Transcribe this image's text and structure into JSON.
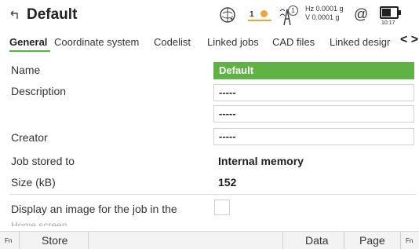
{
  "header": {
    "title": "Default",
    "satellites": "1",
    "tilt_badge": "1",
    "accuracy_hz": "Hz 0.0001 g",
    "accuracy_v": "V  0.0001 g",
    "at_symbol": "@",
    "time": "10:17",
    "battery_level": 0.7
  },
  "tabs": {
    "items": [
      "General",
      "Coordinate system",
      "Codelist",
      "Linked jobs",
      "CAD files",
      "Linked desigr"
    ],
    "active": "General",
    "nav_arrows": "< >"
  },
  "form": {
    "name_label": "Name",
    "name_value": "Default",
    "description_label": "Description",
    "description_value_1": "-----",
    "description_value_2": "-----",
    "creator_label": "Creator",
    "creator_value": "-----",
    "stored_label": "Job stored to",
    "stored_value": "Internal memory",
    "size_label": "Size (kB)",
    "size_value": "152",
    "image_label": "Display an image for the job in the",
    "image_label_cont": "Home screen",
    "image_checked": false
  },
  "bottombar": {
    "fn_left": "Fn",
    "store": "Store",
    "data": "Data",
    "page": "Page",
    "fn_right": "Fn"
  },
  "colors": {
    "accent_green": "#5fb244",
    "sats_orange": "#f3a23a"
  }
}
